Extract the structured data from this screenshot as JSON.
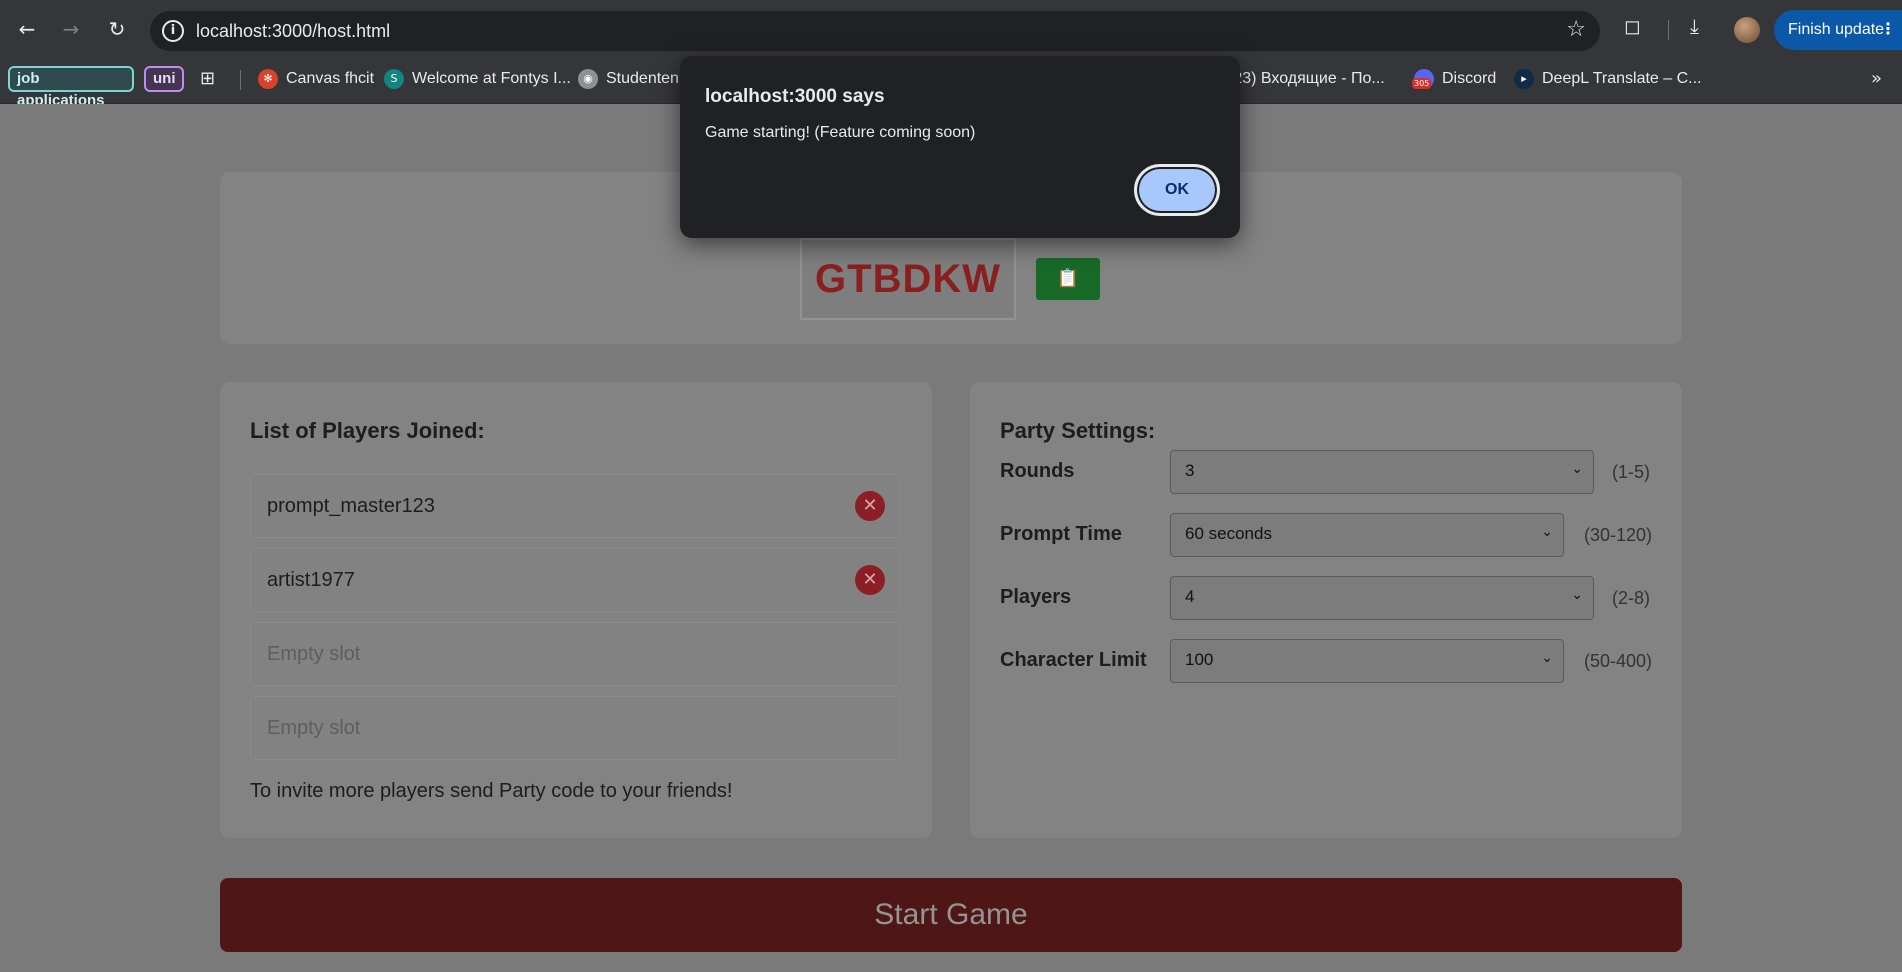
{
  "browser": {
    "url": "localhost:3000/host.html",
    "update_button": "Finish update",
    "bookmarks": {
      "chip1": "job applications",
      "chip2": "uni",
      "items": [
        "Canvas fhcit",
        "Welcome at Fontys I...",
        "Studentenp",
        "(23) Входящие - По...",
        "Discord",
        "DeepL Translate – C..."
      ],
      "discord_badge": "305"
    }
  },
  "dialog": {
    "title": "localhost:3000 says",
    "message": "Game starting! (Feature coming soon)",
    "ok_label": "OK"
  },
  "party": {
    "code": "GTBDKW",
    "copy_icon": "clipboard-icon"
  },
  "players": {
    "title": "List of Players Joined:",
    "slots": [
      "prompt_master123",
      "artist1977",
      "Empty slot",
      "Empty slot"
    ],
    "invite_text": "To invite more players send Party code to your friends!"
  },
  "settings": {
    "title": "Party Settings:",
    "rows": [
      {
        "label": "Rounds",
        "value": "3",
        "range": "(1-5)"
      },
      {
        "label": "Prompt Time",
        "value": "60 seconds",
        "range": "(30-120)"
      },
      {
        "label": "Players",
        "value": "4",
        "range": "(2-8)"
      },
      {
        "label": "Character Limit",
        "value": "100",
        "range": "(50-400)"
      }
    ]
  },
  "start_button": "Start Game",
  "colors": {
    "accent_red": "#8a1f1f",
    "copy_green": "#186a28",
    "dialog_ok": "#a8c7fa"
  }
}
